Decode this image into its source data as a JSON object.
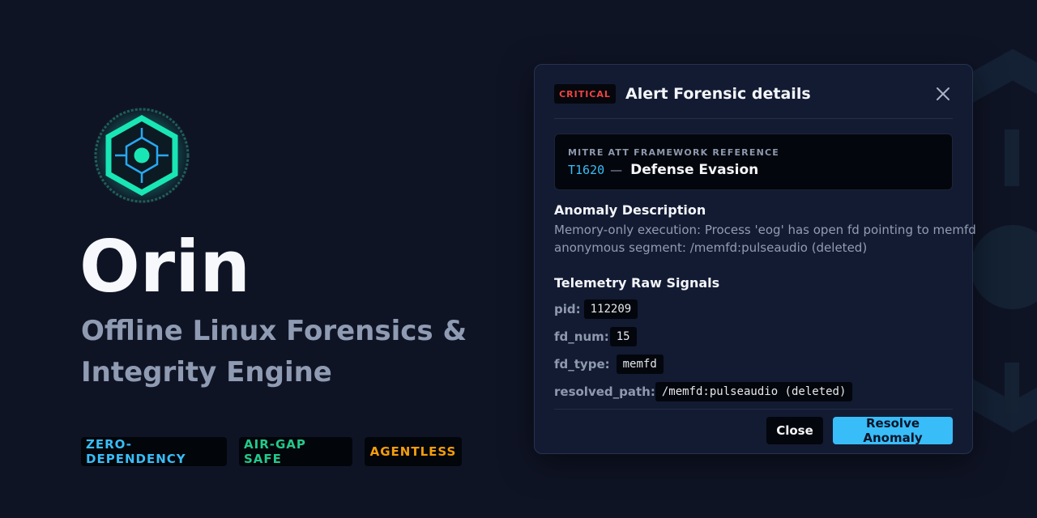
{
  "hero": {
    "title": "Orin",
    "subtitle": "Offline Linux Forensics & Integrity Engine",
    "badges": [
      "ZERO-DEPENDENCY",
      "AIR-GAP SAFE",
      "AGENTLESS"
    ]
  },
  "modal": {
    "severity": "CRITICAL",
    "title": "Alert Forensic details",
    "mitre": {
      "label": "MITRE ATT FRAMEWORK REFERENCE",
      "id": "T1620",
      "separator": "—",
      "tactic": "Defense Evasion"
    },
    "description": {
      "heading": "Anomaly Description",
      "text": "Memory-only execution: Process 'eog' has open fd pointing to memfd anonymous segment: /memfd:pulseaudio (deleted)"
    },
    "signals": {
      "heading": "Telemetry Raw Signals",
      "items": [
        {
          "key": "pid:",
          "value": "112209"
        },
        {
          "key": "fd_num:",
          "value": "15"
        },
        {
          "key": "fd_type:",
          "value": "memfd"
        },
        {
          "key": "resolved_path:",
          "value": "/memfd:pulseaudio (deleted)"
        }
      ]
    },
    "buttons": {
      "close": "Close",
      "resolve": "Resolve Anomaly"
    }
  },
  "colors": {
    "background": "#0f1425",
    "accent": "#38bdf8",
    "logo": "#19e6b5",
    "critical": "#ef4444",
    "green": "#22c98a",
    "amber": "#f59e0b"
  },
  "icons": {
    "logo": "hexagon-target-icon",
    "close": "close-icon",
    "decor": "hexagon-watermark-icon"
  }
}
